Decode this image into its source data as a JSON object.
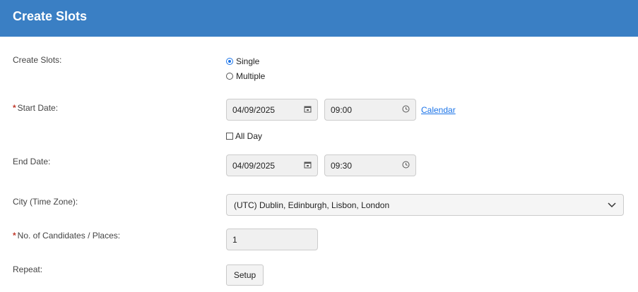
{
  "header": {
    "title": "Create Slots",
    "color": "#3a7fc4"
  },
  "form": {
    "create_slots": {
      "label": "Create Slots:",
      "options": [
        {
          "label": "Single",
          "checked": true
        },
        {
          "label": "Multiple",
          "checked": false
        }
      ]
    },
    "start_date": {
      "required_mark": "*",
      "label": "Start Date:",
      "date": "04/09/2025",
      "time": "09:00",
      "calendar_link": "Calendar",
      "all_day_label": "All Day",
      "all_day_checked": false
    },
    "end_date": {
      "label": "End Date:",
      "date": "04/09/2025",
      "time": "09:30"
    },
    "city": {
      "label": "City (Time Zone):",
      "value": "(UTC) Dublin, Edinburgh, Lisbon, London"
    },
    "candidates": {
      "required_mark": "*",
      "label": "No. of Candidates / Places:",
      "value": "1"
    },
    "repeat": {
      "label": "Repeat:",
      "button": "Setup"
    }
  },
  "icons": {
    "calendar": "calendar-icon",
    "clock": "clock-icon",
    "chevron": "chevron-down-icon"
  }
}
